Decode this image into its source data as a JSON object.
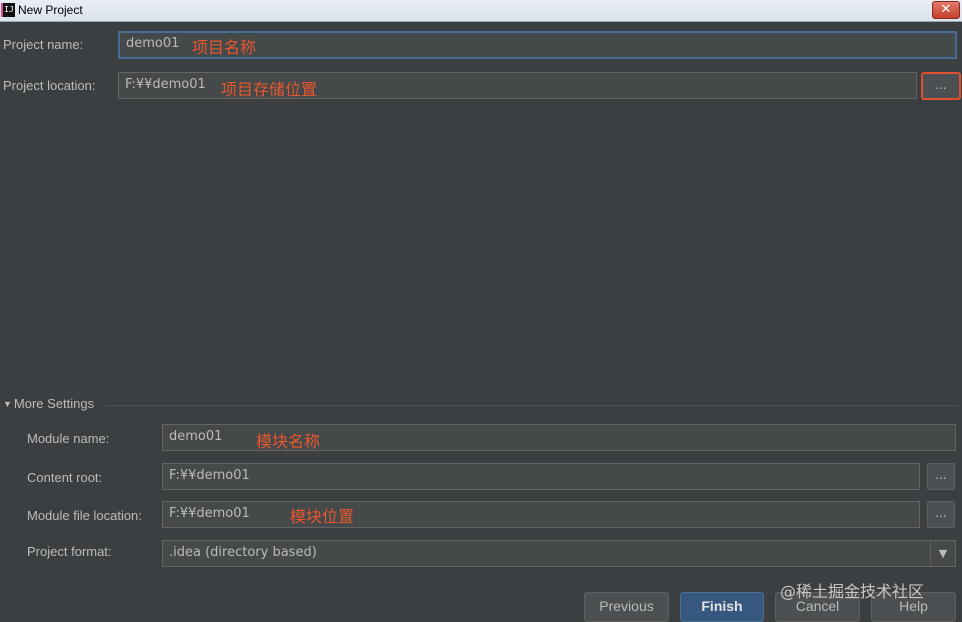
{
  "window": {
    "title": "New Project",
    "app_icon_text": "IJ",
    "close_glyph": "✕"
  },
  "project": {
    "name_label": "Project name:",
    "name_value": "demo01",
    "name_annotation": "项目名称",
    "location_label": "Project location:",
    "location_value": "F:¥¥demo01",
    "location_annotation": "项目存储位置",
    "browse_label": "..."
  },
  "more_settings": {
    "toggle_glyph": "▼",
    "label": "More Settings",
    "module_name_label": "Module name:",
    "module_name_value": "demo01",
    "module_name_annotation": "模块名称",
    "content_root_label": "Content root:",
    "content_root_value": "F:¥¥demo01",
    "module_file_label": "Module file location:",
    "module_file_value": "F:¥¥demo01",
    "module_file_annotation": "模块位置",
    "format_label": "Project format:",
    "format_value": ".idea (directory based)",
    "format_arrow": "▼",
    "browse_label": "..."
  },
  "buttons": {
    "previous": "Previous",
    "finish": "Finish",
    "cancel": "Cancel",
    "help": "Help"
  },
  "watermark": "@稀土掘金技术社区",
  "colors": {
    "background": "#3c3f41",
    "field": "#45494a",
    "annotation": "#e8572e",
    "focus": "#466d94",
    "primary_button": "#365880"
  }
}
